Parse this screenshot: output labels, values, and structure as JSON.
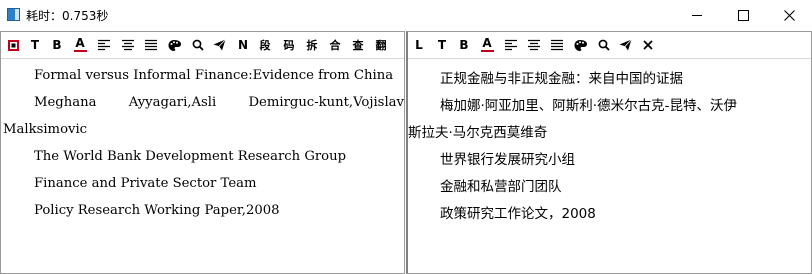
{
  "window": {
    "title": "耗时：0.753秒"
  },
  "left_toolbar": {
    "t_label": "T",
    "b_label": "B",
    "a_label": "A",
    "n_label": "N",
    "seg_label": "段",
    "code_label": "码",
    "split_label": "拆",
    "merge_label": "合",
    "lookup_label": "查",
    "translate_label": "翻"
  },
  "right_toolbar": {
    "l_label": "L",
    "t_label": "T",
    "b_label": "B",
    "a_label": "A"
  },
  "source": {
    "title": "Formal versus Informal Finance:Evidence from China",
    "author_line_1": [
      "Meghana",
      "Ayyagari,Asli",
      "Demirguc-kunt,Vojislav"
    ],
    "author_line_2": "Malksimovic",
    "org": "The World Bank Development Research Group",
    "team": "Finance and Private Sector Team",
    "series": "Policy Research Working Paper,2008"
  },
  "translation": {
    "title": "正规金融与非正规金融：来自中国的证据",
    "authors_line_1": "梅加娜·阿亚加里、阿斯利·德米尔古克-昆特、沃伊",
    "authors_line_2": "斯拉夫·马尔克西莫维奇",
    "org": "世界银行发展研究小组",
    "team": "金融和私营部门团队",
    "series": "政策研究工作论文，2008"
  },
  "colors": {
    "accent_red": "#c0001a",
    "app_icon": "#2f80c7"
  }
}
